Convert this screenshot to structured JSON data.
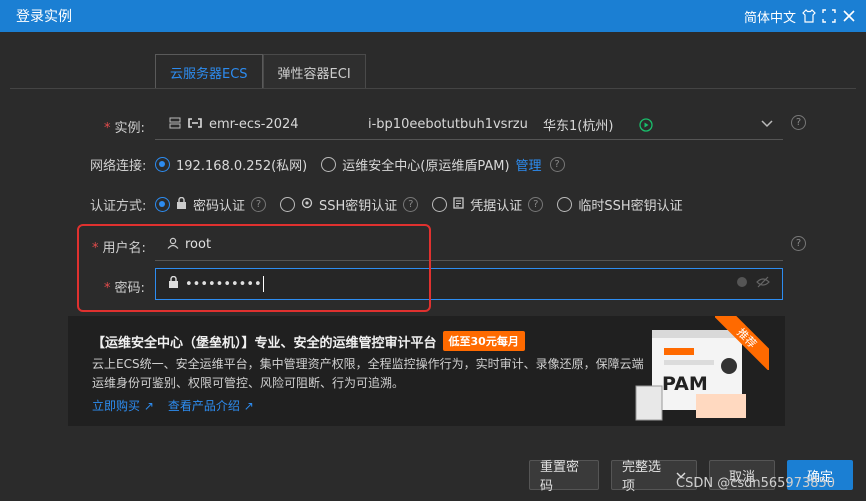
{
  "window": {
    "title": "登录实例",
    "lang": "简体中文"
  },
  "tabs": [
    {
      "label": "云服务器ECS",
      "active": true
    },
    {
      "label": "弹性容器ECI",
      "active": false
    }
  ],
  "instance": {
    "label": "实例:",
    "name": "emr-ecs-2024",
    "id": "i-bp10eebotutbuh1vsrzu",
    "region": "华东1(杭州)"
  },
  "network": {
    "label": "网络连接:",
    "options": [
      {
        "label": "192.168.0.252(私网)",
        "selected": true
      },
      {
        "label": "运维安全中心(原运维盾PAM)",
        "selected": false
      }
    ],
    "manage_link": "管理"
  },
  "auth": {
    "label": "认证方式:",
    "options": [
      {
        "label": "密码认证",
        "selected": true
      },
      {
        "label": "SSH密钥认证",
        "selected": false
      },
      {
        "label": "凭据认证",
        "selected": false
      },
      {
        "label": "临时SSH密钥认证",
        "selected": false
      }
    ]
  },
  "username": {
    "label": "用户名:",
    "value": "root"
  },
  "password": {
    "label": "密码:",
    "value": "••••••••••"
  },
  "banner": {
    "title": "【运维安全中心（堡垒机）】专业、安全的运维管控审计平台",
    "badge": "低至30元每月",
    "desc": "云上ECS统一、安全运维平台，集中管理资产权限，全程监控操作行为，实时审计、录像还原，保障云端运维身份可鉴别、权限可管控、风险可阻断、行为可追溯。",
    "buy_link": "立即购买",
    "intro_link": "查看产品介绍",
    "ribbon": "推荐",
    "pam": "PAM"
  },
  "buttons": {
    "reset": "重置密码",
    "full_options": "完整选项",
    "cancel": "取消",
    "confirm": "确定"
  },
  "watermark": "CSDN @csdn565973850",
  "colors": {
    "accent": "#1b7fd3",
    "link": "#2d8cf0",
    "highlight": "#e0312f",
    "badge": "#ff6a00"
  }
}
